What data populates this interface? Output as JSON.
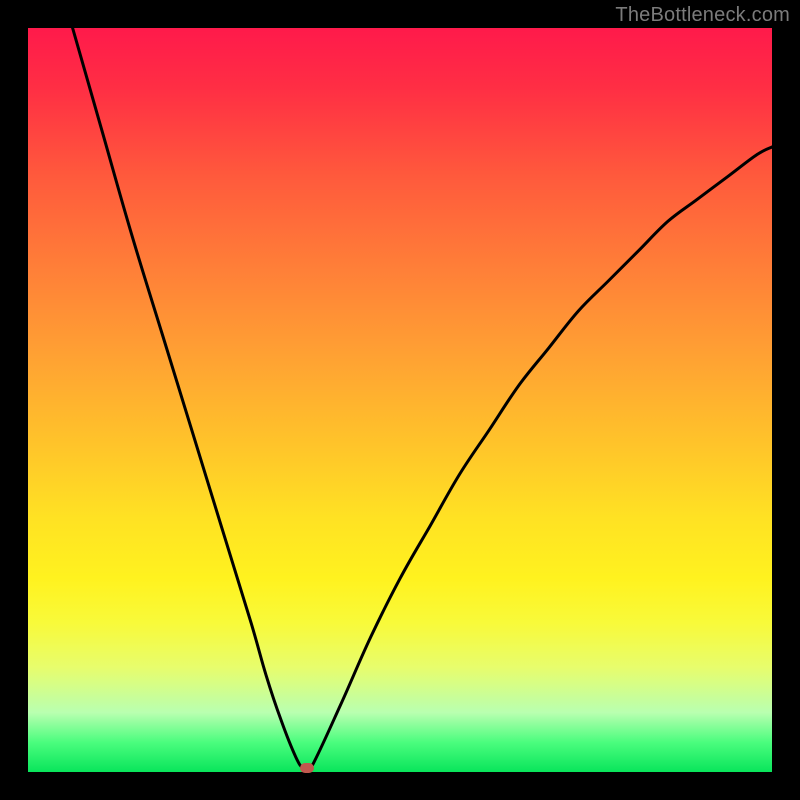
{
  "attribution": "TheBottleneck.com",
  "colors": {
    "frame": "#000000",
    "gradient_top": "#ff1a4b",
    "gradient_bottom": "#09e55b",
    "curve": "#000000",
    "marker": "#c1584e",
    "attribution_text": "#7b7b7b"
  },
  "chart_data": {
    "type": "line",
    "title": "",
    "xlabel": "",
    "ylabel": "",
    "xlim": [
      0,
      100
    ],
    "ylim": [
      0,
      100
    ],
    "grid": false,
    "legend": false,
    "annotations": [],
    "series": [
      {
        "name": "bottleneck-curve",
        "x": [
          6,
          10,
          14,
          18,
          22,
          26,
          30,
          32,
          34,
          36,
          37,
          38,
          42,
          46,
          50,
          54,
          58,
          62,
          66,
          70,
          74,
          78,
          82,
          86,
          90,
          94,
          98,
          100
        ],
        "y": [
          100,
          86,
          72,
          59,
          46,
          33,
          20,
          13,
          7,
          2,
          0.5,
          0.5,
          9,
          18,
          26,
          33,
          40,
          46,
          52,
          57,
          62,
          66,
          70,
          74,
          77,
          80,
          83,
          84
        ]
      }
    ],
    "marker": {
      "x": 37.5,
      "y": 0.5
    }
  }
}
